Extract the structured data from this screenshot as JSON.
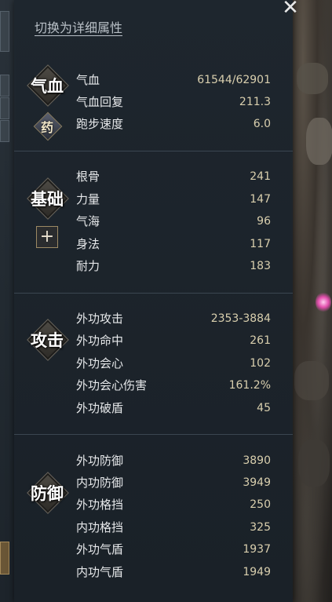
{
  "panel": {
    "toggle_label": "切换为详细属性",
    "close_glyph": "✕"
  },
  "sections": {
    "vitality": {
      "emblem": "气血",
      "medicine_label": "药",
      "rows": [
        {
          "name": "气血",
          "value": "61544/62901"
        },
        {
          "name": "气血回复",
          "value": "211.3"
        },
        {
          "name": "跑步速度",
          "value": "6.0"
        }
      ]
    },
    "base": {
      "emblem": "基础",
      "plus_label": "+",
      "rows": [
        {
          "name": "根骨",
          "value": "241"
        },
        {
          "name": "力量",
          "value": "147"
        },
        {
          "name": "气海",
          "value": "96"
        },
        {
          "name": "身法",
          "value": "117"
        },
        {
          "name": "耐力",
          "value": "183"
        }
      ]
    },
    "attack": {
      "emblem": "攻击",
      "rows": [
        {
          "name": "外功攻击",
          "value": "2353-3884"
        },
        {
          "name": "外功命中",
          "value": "261"
        },
        {
          "name": "外功会心",
          "value": "102"
        },
        {
          "name": "外功会心伤害",
          "value": "161.2%"
        },
        {
          "name": "外功破盾",
          "value": "45"
        }
      ]
    },
    "defense": {
      "emblem": "防御",
      "rows": [
        {
          "name": "外功防御",
          "value": "3890"
        },
        {
          "name": "内功防御",
          "value": "3949"
        },
        {
          "name": "外功格挡",
          "value": "250"
        },
        {
          "name": "内功格挡",
          "value": "325"
        },
        {
          "name": "外功气盾",
          "value": "1937"
        },
        {
          "name": "内功气盾",
          "value": "1949"
        }
      ]
    }
  }
}
